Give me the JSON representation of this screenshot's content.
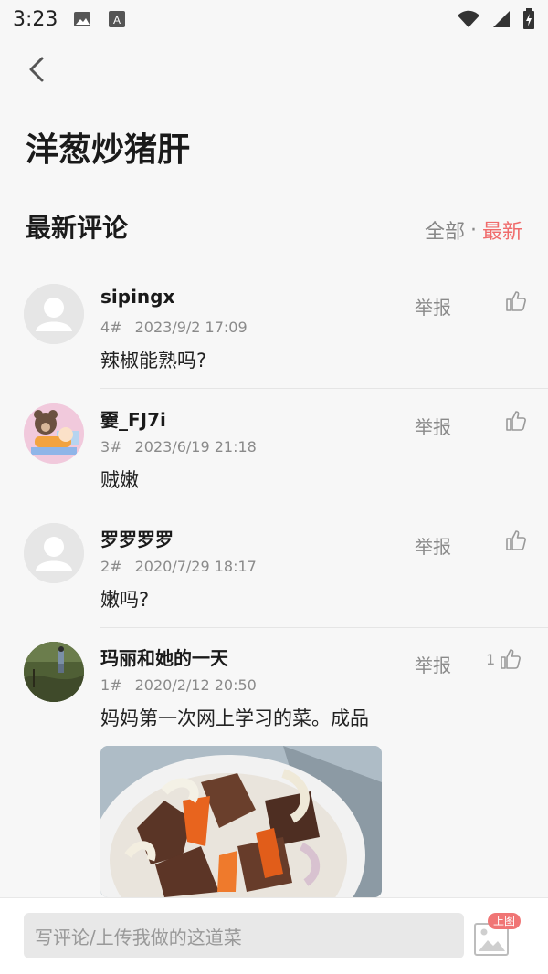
{
  "status": {
    "time": "3:23"
  },
  "page": {
    "title": "洋葱炒猪肝"
  },
  "comments_section": {
    "title": "最新评论",
    "sort_all": "全部",
    "sort_sep": "·",
    "sort_latest": "最新"
  },
  "comments": [
    {
      "user": "sipingx",
      "floor": "4#",
      "time": "2023/9/2 17:09",
      "text": "辣椒能熟吗?",
      "report": "举报",
      "likes": ""
    },
    {
      "user": "嫑_FJ7i",
      "floor": "3#",
      "time": "2023/6/19 21:18",
      "text": "贼嫩",
      "report": "举报",
      "likes": ""
    },
    {
      "user": "罗罗罗罗",
      "floor": "2#",
      "time": "2020/7/29 18:17",
      "text": "嫩吗?",
      "report": "举报",
      "likes": ""
    },
    {
      "user": "玛丽和她的一天",
      "floor": "1#",
      "time": "2020/2/12 20:50",
      "text": "妈妈第一次网上学习的菜。成品",
      "report": "举报",
      "likes": "1"
    }
  ],
  "composer": {
    "placeholder": "写评论/上传我做的这道菜",
    "upload_badge": "上图"
  },
  "colors": {
    "accent": "#f06b6b"
  },
  "icons": [
    "back-icon",
    "image-icon",
    "a-icon",
    "wifi-icon",
    "signal-icon",
    "battery-icon",
    "thumbs-up-icon",
    "upload-image-icon"
  ]
}
